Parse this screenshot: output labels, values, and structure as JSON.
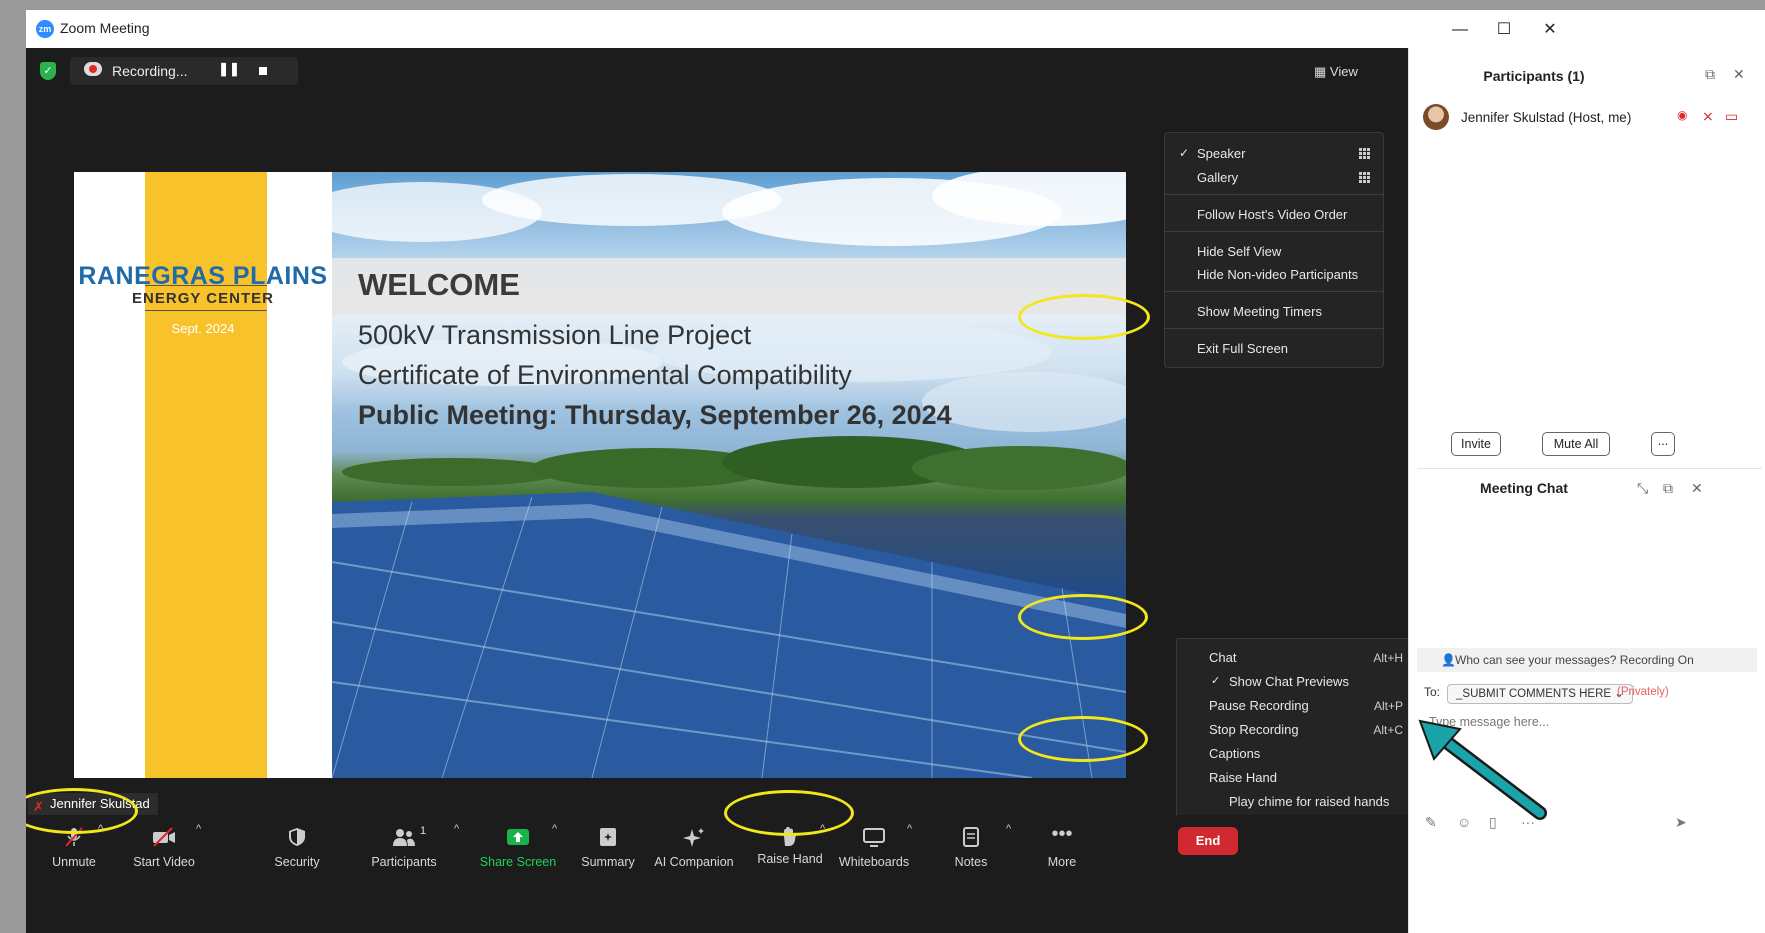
{
  "window": {
    "title": "Zoom Meeting",
    "app_icon": "zm"
  },
  "window_controls": {
    "minimize": "—",
    "maximize": "☐",
    "close": "✕"
  },
  "top_bar": {
    "recording_label": "Recording...",
    "view_label": "View"
  },
  "slide": {
    "brand_name": "RANEGRAS PLAINS",
    "brand_sub": "ENERGY CENTER",
    "date": "Sept. 2024",
    "welcome": "WELCOME",
    "line1": "500kV Transmission Line Project",
    "line2": "Certificate of Environmental Compatibility",
    "line3": "Public Meeting: Thursday, September 26, 2024"
  },
  "view_menu": {
    "speaker": "Speaker",
    "gallery": "Gallery",
    "follow_host": "Follow Host's Video Order",
    "hide_self": "Hide Self View",
    "hide_nonvideo": "Hide Non-video Participants",
    "show_timers": "Show Meeting Timers",
    "exit_full_screen": "Exit Full Screen"
  },
  "more_menu": {
    "chat": "Chat",
    "chat_key": "Alt+H",
    "show_chat_previews": "Show Chat Previews",
    "pause_recording": "Pause Recording",
    "pause_key": "Alt+P",
    "stop_recording": "Stop Recording",
    "stop_key": "Alt+C",
    "captions": "Captions",
    "raise_hand": "Raise Hand",
    "play_chime": "Play chime for raised hands"
  },
  "name_tag": "Jennifer Skulstad",
  "toolbar": {
    "unmute": "Unmute",
    "start_video": "Start Video",
    "security": "Security",
    "participants": "Participants",
    "participants_count": "1",
    "share_screen": "Share Screen",
    "summary": "Summary",
    "ai_companion": "AI Companion",
    "raise_hand": "Raise Hand",
    "whiteboards": "Whiteboards",
    "notes": "Notes",
    "more": "More",
    "end": "End"
  },
  "participants_panel": {
    "title": "Participants (1)",
    "participant_name": "Jennifer Skulstad (Host, me)",
    "invite": "Invite",
    "mute_all": "Mute All",
    "more": "..."
  },
  "chat_panel": {
    "title": "Meeting Chat",
    "who_can_see": "Who can see your messages? Recording On",
    "to_label": "To:",
    "recipient": "_SUBMIT COMMENTS HERE",
    "privately": "(Privately)",
    "message_placeholder": "Type message here..."
  },
  "colors": {
    "accent": "#2d8cff",
    "end_button": "#d0292f",
    "annotation": "#f2e71a",
    "arrow": "#1aa3a8",
    "brand_blue": "#1f6aa8",
    "slide_yellow": "#f8c22b"
  }
}
